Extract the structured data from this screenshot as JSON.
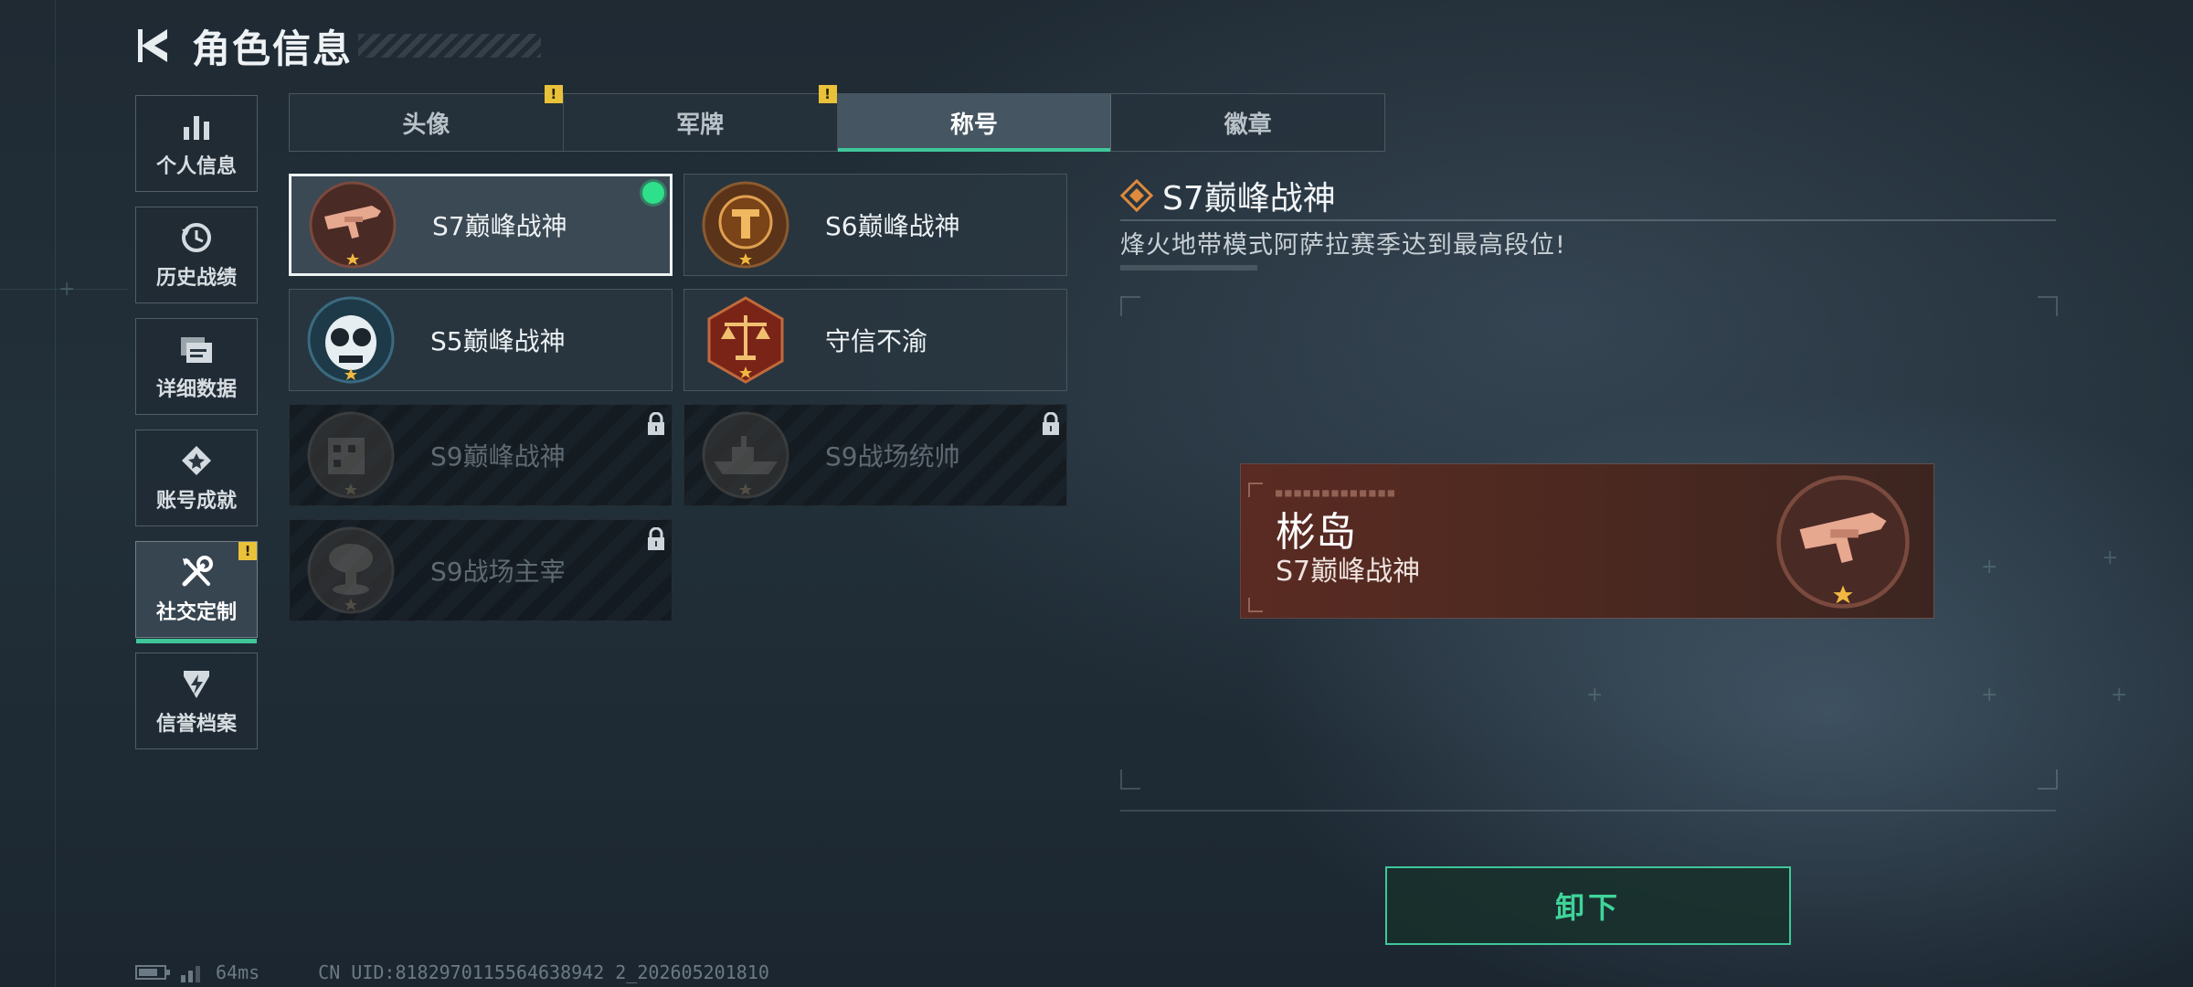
{
  "header": {
    "title": "角色信息"
  },
  "sidebar": {
    "items": [
      {
        "label": "个人信息",
        "icon": "bar-chart-icon"
      },
      {
        "label": "历史战绩",
        "icon": "history-icon"
      },
      {
        "label": "详细数据",
        "icon": "folder-icon"
      },
      {
        "label": "账号成就",
        "icon": "achievement-icon"
      },
      {
        "label": "社交定制",
        "icon": "tools-icon",
        "active": true,
        "badge": "!"
      },
      {
        "label": "信誉档案",
        "icon": "credit-icon"
      }
    ]
  },
  "tabs": [
    {
      "label": "头像",
      "badge": "!"
    },
    {
      "label": "军牌",
      "badge": "!"
    },
    {
      "label": "称号",
      "active": true
    },
    {
      "label": "徽章"
    }
  ],
  "titles": [
    {
      "name": "S7巅峰战神",
      "state": "equipped",
      "emblem": "rifle-emblem-icon"
    },
    {
      "name": "S6巅峰战神",
      "state": "owned",
      "emblem": "t-laurel-emblem-icon"
    },
    {
      "name": "S5巅峰战神",
      "state": "owned",
      "emblem": "skull-goggles-emblem-icon"
    },
    {
      "name": "守信不渝",
      "state": "owned",
      "emblem": "scales-emblem-icon"
    },
    {
      "name": "S9巅峰战神",
      "state": "locked",
      "emblem": "building-emblem-icon"
    },
    {
      "name": "S9战场统帅",
      "state": "locked",
      "emblem": "ship-emblem-icon"
    },
    {
      "name": "S9战场主宰",
      "state": "locked",
      "emblem": "mushroom-cloud-emblem-icon"
    }
  ],
  "detail": {
    "title": "S7巅峰战神",
    "description": "烽火地带模式阿萨拉赛季达到最高段位!"
  },
  "preview": {
    "player_name": "彬岛",
    "title": "S7巅峰战神"
  },
  "action": {
    "unequip_label": "卸下"
  },
  "footer": {
    "ping": "64ms",
    "uid": "CN UID:8182970115564638942 2_202605201810"
  },
  "colors": {
    "accent": "#3fc79a",
    "equipped_dot": "#2fe08a",
    "badge": "#e9c23a",
    "preview_bg": "#5a2b22"
  }
}
